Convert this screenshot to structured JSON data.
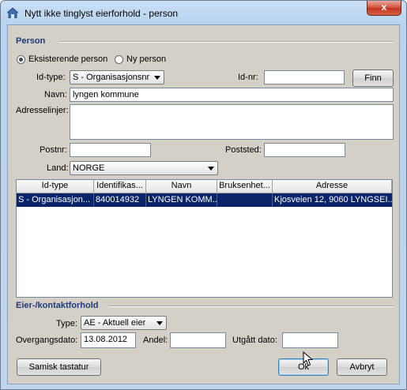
{
  "window": {
    "title": "Nytt ikke tinglyst eierforhold - person",
    "close_label": "x"
  },
  "person": {
    "section_title": "Person",
    "radio_existing": "Eksisterende person",
    "radio_new": "Ny person",
    "selected_radio": "existing",
    "idtype_label": "Id-type:",
    "idtype_value": "S  - Organisasjonsnr",
    "idnr_label": "Id-nr:",
    "idnr_value": "",
    "find_button": "Finn",
    "name_label": "Navn:",
    "name_value": "lyngen kommune",
    "address_label": "Adresselinjer:",
    "postnr_label": "Postnr:",
    "postnr_value": "",
    "poststed_label": "Poststed:",
    "poststed_value": "",
    "country_label": "Land:",
    "country_value": "NORGE"
  },
  "results": {
    "columns": [
      "Id-type",
      "Identifikas...",
      "Navn",
      "Bruksenhet...",
      "Adresse"
    ],
    "rows": [
      [
        "S  - Organisasjon...",
        "840014932",
        "LYNGEN KOMM...",
        "",
        "Kjosveien 12, 9060 LYNGSEI..."
      ]
    ]
  },
  "owner": {
    "section_title": "Eier-/kontaktforhold",
    "type_label": "Type:",
    "type_value": "AE - Aktuell eier",
    "transition_label": "Overgangsdato:",
    "transition_value": "13.08.2012",
    "share_label": "Andel:",
    "share_value": "",
    "expired_label": "Utgått dato:",
    "expired_value": ""
  },
  "buttons": {
    "sami_keyboard": "Samisk tastatur",
    "ok": "Ok",
    "cancel": "Avbryt"
  },
  "icons": {
    "app": "house-icon",
    "close": "close-icon",
    "dropdown": "chevron-down-icon",
    "cursor": "mouse-cursor-icon"
  }
}
